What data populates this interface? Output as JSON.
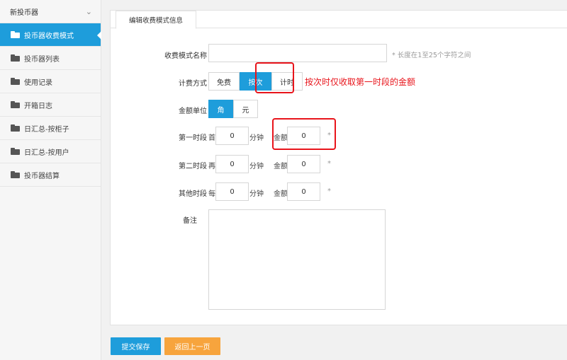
{
  "sidebar": {
    "header": "新投币器",
    "items": [
      {
        "label": "投币器收费模式",
        "active": true
      },
      {
        "label": "投币器列表"
      },
      {
        "label": "使用记录"
      },
      {
        "label": "开箱日志"
      },
      {
        "label": "日汇总-按柜子"
      },
      {
        "label": "日汇总-按用户"
      },
      {
        "label": "投币器结算"
      }
    ]
  },
  "tab": {
    "label": "编辑收费模式信息"
  },
  "form": {
    "name_label": "收费模式名称",
    "name_value": "",
    "name_hint": "* 长度在1至25个字符之间",
    "billing_label": "计费方式",
    "billing_options": [
      "免费",
      "按次",
      "计时"
    ],
    "billing_selected": "按次",
    "unit_label": "金额单位",
    "unit_options": [
      "角",
      "元"
    ],
    "unit_selected": "角",
    "seg1_label": "第一时段",
    "seg1_prefix": "首",
    "seg1_minutes": "0",
    "seg2_label": "第二时段",
    "seg2_prefix": "再",
    "seg2_minutes": "0",
    "seg3_label": "其他时段",
    "seg3_prefix": "每",
    "seg3_minutes": "0",
    "minutes_unit": "分钟",
    "amount_label": "金额",
    "seg1_amount": "0",
    "seg2_amount": "0",
    "seg3_amount": "0",
    "required_mark": "*",
    "remark_label": "备注",
    "remark_value": ""
  },
  "annotation": {
    "text": "按次时仅收取第一时段的金额",
    "color": "#e8141b"
  },
  "buttons": {
    "save": "提交保存",
    "back": "返回上一页"
  },
  "colors": {
    "accent": "#1e9ddb",
    "back_button": "#f7a43d"
  }
}
